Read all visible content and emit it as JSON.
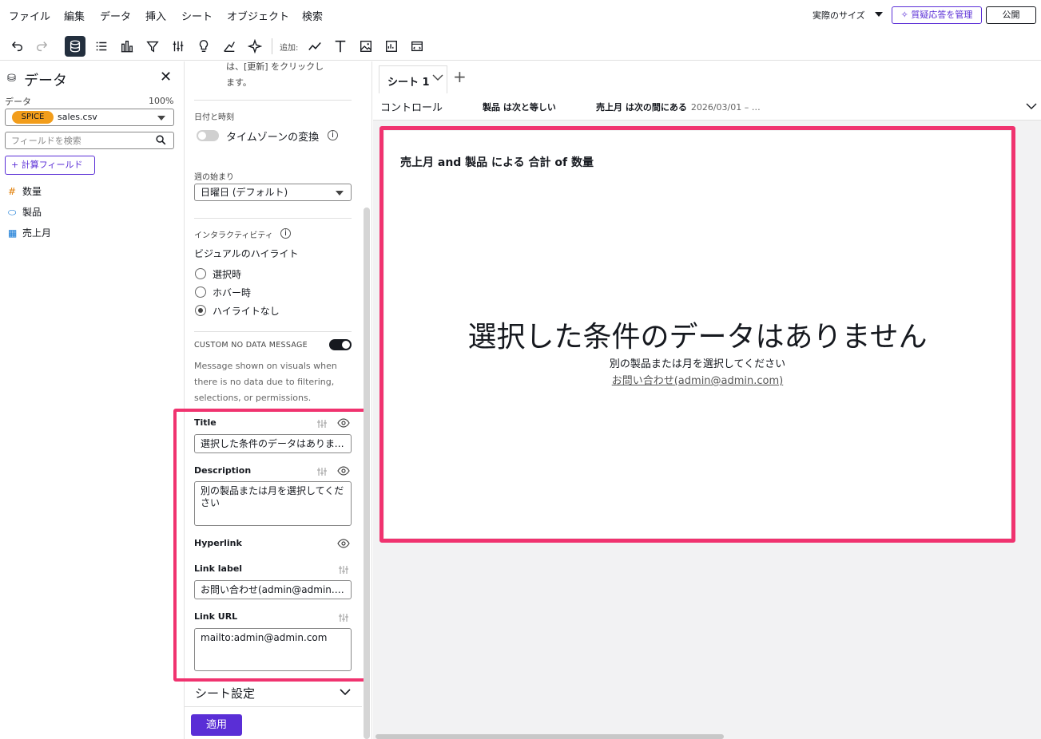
{
  "menu": [
    "ファイル",
    "編集",
    "データ",
    "挿入",
    "シート",
    "オブジェクト",
    "検索"
  ],
  "topbar": {
    "actual_size": "実際のサイズ",
    "qa_button": "質疑応答を管理",
    "publish_button": "公開"
  },
  "toolbar": {
    "add_label": "追加:"
  },
  "data_panel": {
    "title": "データ",
    "dataset_label": "データ",
    "percent": "100%",
    "spice": "SPICE",
    "dataset": "sales.csv",
    "search_placeholder": "フィールドを検索",
    "calc_field": "計算フィールド",
    "fields": [
      {
        "name": "数量",
        "icon": "measure-icon"
      },
      {
        "name": "製品",
        "icon": "dimension-icon"
      },
      {
        "name": "売上月",
        "icon": "calendar-icon"
      }
    ]
  },
  "props": {
    "top_text_1": "は、[更新] をクリックし",
    "top_text_2": "ます。",
    "date_time_label": "日付と時刻",
    "timezone_toggle": "タイムゾーンの変換",
    "week_start_label": "週の始まり",
    "week_start_value": "日曜日 (デフォルト)",
    "interactivity_label": "インタラクティビティ",
    "highlight_label": "ビジュアルのハイライト",
    "radio_options": [
      "選択時",
      "ホバー時",
      "ハイライトなし"
    ],
    "radio_selected": 2,
    "custom_no_data_label": "CUSTOM NO DATA MESSAGE",
    "custom_no_data_help_1": "Message shown on visuals when",
    "custom_no_data_help_2": "there is no data due to filtering,",
    "custom_no_data_help_3": "selections, or permissions.",
    "title_label": "Title",
    "title_value": "選択した条件のデータはありません",
    "description_label": "Description",
    "description_value": "別の製品または月を選択してください",
    "hyperlink_label": "Hyperlink",
    "link_label_label": "Link label",
    "link_label_value": "お問い合わせ(admin@admin.com)",
    "link_url_label": "Link URL",
    "link_url_value": "mailto:admin@admin.com",
    "sheet_settings": "シート設定",
    "apply": "適用"
  },
  "canvas": {
    "sheet_tab": "シート 1",
    "controls_label": "コントロール",
    "control_1": "製品 は次と等しい",
    "control_2": "売上月 は次の間にある",
    "control_2_value": "2026/03/01 – …",
    "visual_title": "売上月 and 製品 による 合計 of 数量",
    "no_data_title": "選択した条件のデータはありません",
    "no_data_desc": "別の製品または月を選択してください",
    "no_data_link": "お問い合わせ(admin@admin.com)"
  },
  "colors": {
    "accent": "#5a2ed6",
    "highlight": "#f0336f",
    "spice": "#f29d1b"
  }
}
